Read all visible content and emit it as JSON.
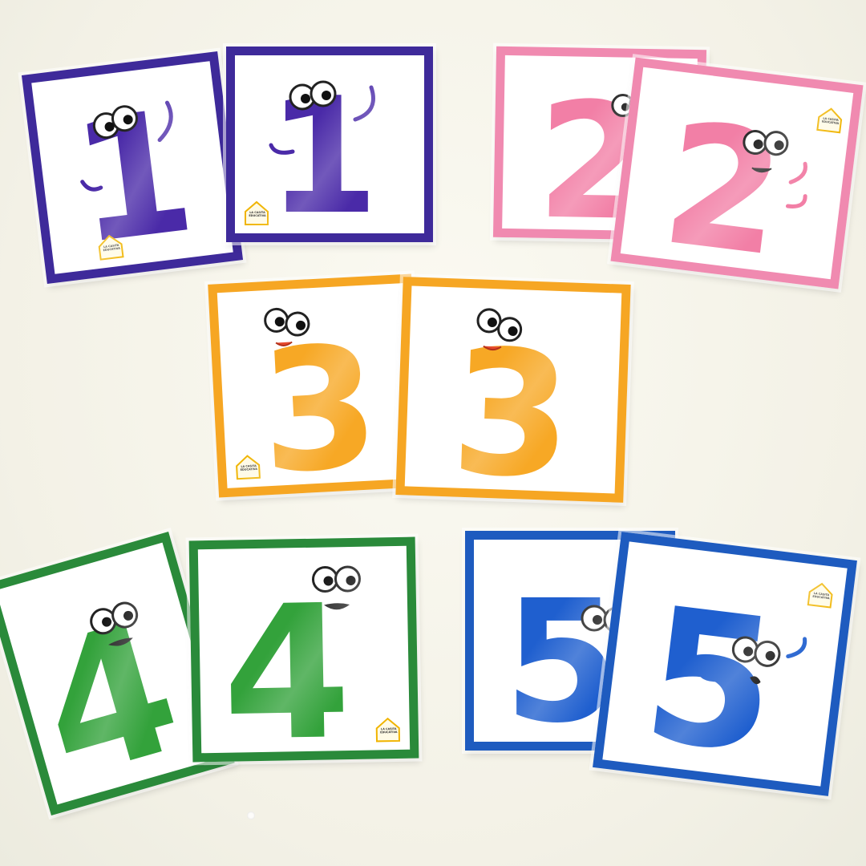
{
  "scene": {
    "background_color": "#f5f3e9",
    "logo_text": "LA CASITA\nEDUCATIVA"
  },
  "cards": [
    {
      "id": "one-a",
      "numeral": "1",
      "color": "#4a2aa8",
      "frame": "#3e2a9a"
    },
    {
      "id": "one-b",
      "numeral": "1",
      "color": "#4a2aa8",
      "frame": "#3e2a9a"
    },
    {
      "id": "two-a",
      "numeral": "2",
      "color": "#f27fa6",
      "frame": "#f08ab0"
    },
    {
      "id": "two-b",
      "numeral": "2",
      "color": "#f27fa6",
      "frame": "#f08ab0"
    },
    {
      "id": "three-a",
      "numeral": "3",
      "color": "#f7a825",
      "frame": "#f6a623"
    },
    {
      "id": "three-b",
      "numeral": "3",
      "color": "#f7a825",
      "frame": "#f6a623"
    },
    {
      "id": "four-a",
      "numeral": "4",
      "color": "#33a23b",
      "frame": "#2a8a3a"
    },
    {
      "id": "four-b",
      "numeral": "4",
      "color": "#33a23b",
      "frame": "#2a8a3a"
    },
    {
      "id": "five-a",
      "numeral": "5",
      "color": "#1f5fcf",
      "frame": "#1e5bbf"
    },
    {
      "id": "five-b",
      "numeral": "5",
      "color": "#1f5fcf",
      "frame": "#1e5bbf"
    }
  ]
}
